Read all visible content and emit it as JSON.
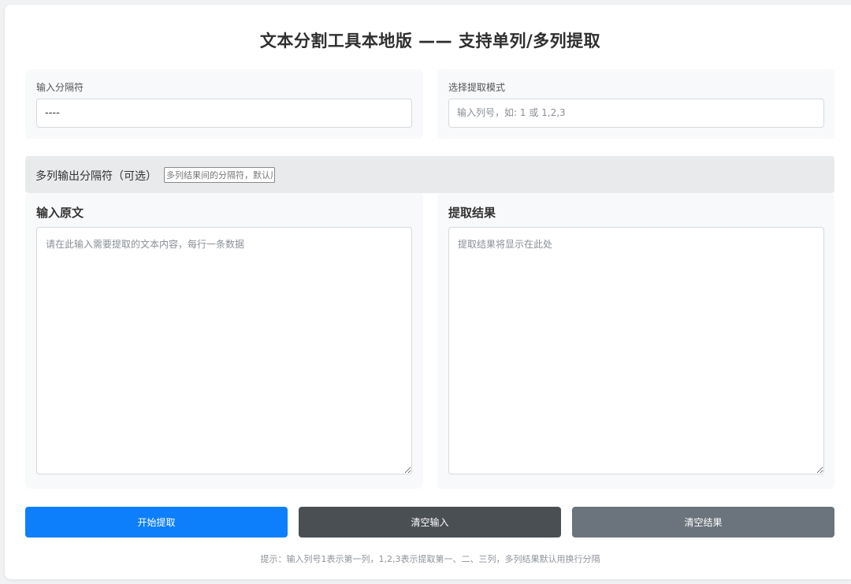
{
  "title": "文本分割工具本地版 —— 支持单列/多列提取",
  "delimiter": {
    "label": "输入分隔符",
    "value": "----"
  },
  "mode": {
    "label": "选择提取模式",
    "placeholder": "输入列号，如: 1 或 1,2,3"
  },
  "multi_output": {
    "label": "多列输出分隔符（可选）",
    "placeholder": "多列结果间的分隔符，默认用换行分隔"
  },
  "input_text": {
    "title": "输入原文",
    "placeholder": "请在此输入需要提取的文本内容，每行一条数据"
  },
  "result_text": {
    "title": "提取结果",
    "placeholder": "提取结果将显示在此处"
  },
  "buttons": {
    "start": "开始提取",
    "clear_input": "清空输入",
    "clear_result": "清空结果"
  },
  "colors": {
    "start": "#0d7ffb",
    "clear_input": "#4a4f54",
    "clear_result": "#6b747c"
  },
  "hint": "提示：输入列号1表示第一列，1,2,3表示提取第一、二、三列，多列结果默认用换行分隔"
}
